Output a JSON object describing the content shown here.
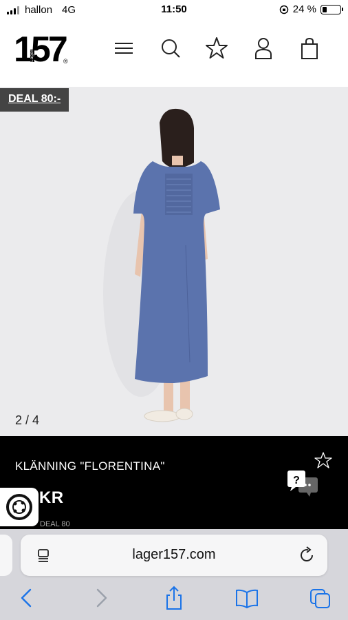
{
  "status_bar": {
    "carrier": "hallon",
    "network": "4G",
    "time": "11:50",
    "battery": "24 %",
    "battery_level": 0.24
  },
  "header": {
    "logo_text": "157",
    "logo_small_text": "Lager",
    "logo_registered": "®",
    "icons": [
      "menu-icon",
      "search-icon",
      "star-icon",
      "user-icon",
      "bag-icon"
    ]
  },
  "product": {
    "deal_badge": "DEAL 80:-",
    "image_counter": "2 / 4",
    "name": "KLÄNNING \"FLORENTINA\"",
    "price": "50 KR",
    "deal_line": "DEAL 80"
  },
  "colors": {
    "dress": "#5b73ad",
    "image_bg": "#ebebed",
    "info_bg": "#000000",
    "badge_bg": "#444444"
  },
  "browser": {
    "url": "lager157.com",
    "toolbar": [
      "back-icon",
      "forward-icon",
      "share-icon",
      "bookmarks-icon",
      "tabs-icon"
    ]
  }
}
